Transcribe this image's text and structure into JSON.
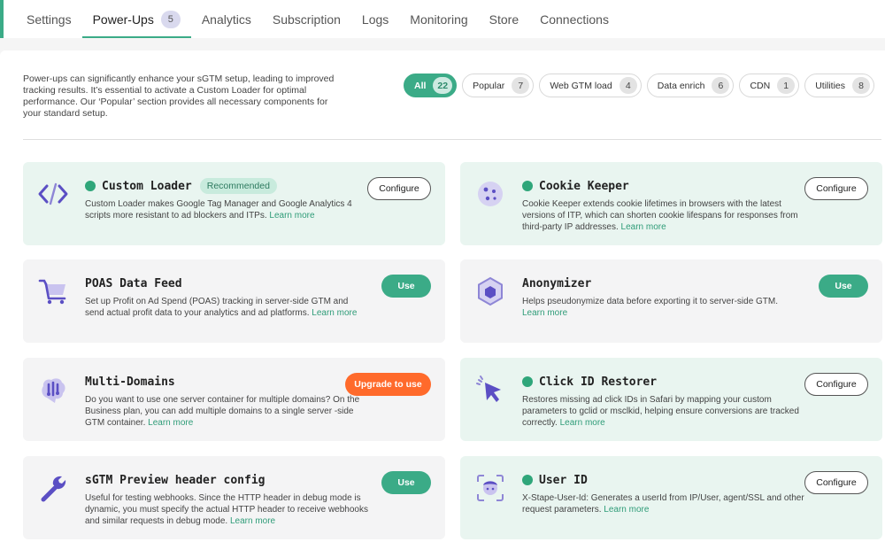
{
  "tabs": [
    {
      "label": "Settings"
    },
    {
      "label": "Power-Ups",
      "count": "5"
    },
    {
      "label": "Analytics"
    },
    {
      "label": "Subscription"
    },
    {
      "label": "Logs"
    },
    {
      "label": "Monitoring"
    },
    {
      "label": "Store"
    },
    {
      "label": "Connections"
    }
  ],
  "intro": "Power-ups can significantly enhance your sGTM setup, leading to improved tracking results. It’s essential to activate a Custom Loader for optimal performance. Our ‘Popular’ section provides all necessary components for your standard setup.",
  "filters": [
    {
      "label": "All",
      "count": "22"
    },
    {
      "label": "Popular",
      "count": "7"
    },
    {
      "label": "Web GTM load",
      "count": "4"
    },
    {
      "label": "Data enrich",
      "count": "6"
    },
    {
      "label": "CDN",
      "count": "1"
    },
    {
      "label": "Utilities",
      "count": "8"
    }
  ],
  "colors": {
    "accent": "#3bab87",
    "upgrade": "#ff6a2b",
    "icon": "#5b4fc4",
    "enabled_card": "#e9f5f0"
  },
  "cards": [
    {
      "title": "Custom Loader",
      "badge": "Recommended",
      "desc": "Custom Loader makes Google Tag Manager and Google Analytics 4 scripts more resistant to ad blockers and ITPs.",
      "more": "Learn more",
      "button": "Configure",
      "icon": "code-icon"
    },
    {
      "title": "Cookie Keeper",
      "desc": "Cookie Keeper extends cookie lifetimes in browsers with the latest versions of ITP, which can shorten cookie lifespans for responses from third-party IP addresses.",
      "more": "Learn more",
      "button": "Configure",
      "icon": "cookie-icon"
    },
    {
      "title": "POAS Data Feed",
      "desc": "Set up Profit on Ad Spend (POAS) tracking in server-side GTM and send actual profit data to your analytics and ad platforms.",
      "more": "Learn more",
      "button": "Use",
      "icon": "cart-icon"
    },
    {
      "title": "Anonymizer",
      "desc": "Helps pseudonymize data before exporting it to server-side GTM.",
      "more": "Learn more",
      "button": "Use",
      "icon": "hexagon-icon"
    },
    {
      "title": "Multi-Domains",
      "desc": "Do you want to use one server container for multiple domains? On the Business plan, you can add multiple domains to a single server -side GTM container.",
      "more": "Learn more",
      "button": "Upgrade to use",
      "icon": "brain-icon"
    },
    {
      "title": "Click ID Restorer",
      "desc": "Restores missing ad click IDs in Safari by mapping your custom parameters to gclid or msclkid, helping ensure conversions are tracked correctly.",
      "more": "Learn more",
      "button": "Configure",
      "icon": "cursor-click-icon"
    },
    {
      "title": "sGTM Preview header config",
      "desc": "Useful for testing webhooks. Since the HTTP header in debug mode is dynamic, you must specify the actual HTTP header to receive webhooks and similar requests in debug mode.",
      "more": "Learn more",
      "button": "Use",
      "icon": "wrench-icon"
    },
    {
      "title": "User ID",
      "desc": "X-Stape-User-Id: Generates a userId from IP/User, agent/SSL and other request parameters.",
      "more": "Learn more",
      "button": "Configure",
      "icon": "face-scan-icon"
    }
  ]
}
